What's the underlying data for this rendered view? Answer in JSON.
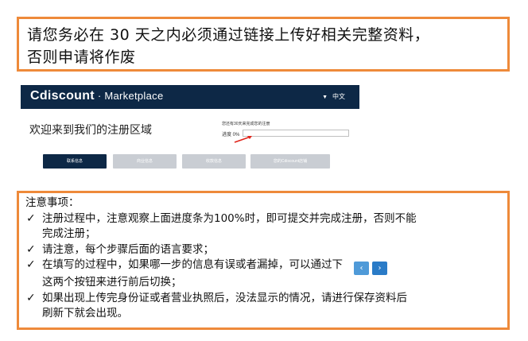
{
  "top_notice": {
    "line1": "请您务必在 30 天之内必须通过链接上传好相关完整资料，",
    "line2": "否则申请将作废"
  },
  "screenshot": {
    "brand": "Cdiscount",
    "brand_sub": " · Marketplace",
    "language": "中文",
    "welcome": "欢迎来到我们的注册区域",
    "days_notice": "您还有30天来完成您的注册",
    "progress_label": "进度 0%",
    "progress_value": 0,
    "steps": [
      "联系信息",
      "商业信息",
      "收款信息",
      "您的Cdiscount店铺"
    ]
  },
  "notes": {
    "title": "注意事项：",
    "items": [
      {
        "lines": [
          "注册过程中，注意观察上面进度条为100%时，即可提交并完成注册，否则不能",
          "完成注册；"
        ]
      },
      {
        "lines": [
          "请注意，每个步骤后面的语言要求；"
        ]
      },
      {
        "line1_pre": "在填写的过程中，如果哪一步的信息有误或者漏掉，可以通过下",
        "line2": "这两个按钮来进行前后切换；"
      },
      {
        "lines": [
          "如果出现上传完身份证或者营业执照后，没法显示的情况，请进行保存资料后",
          "刷新下就会出现。"
        ]
      }
    ],
    "check_glyph": "✓",
    "prev_glyph": "‹",
    "next_glyph": "›"
  }
}
